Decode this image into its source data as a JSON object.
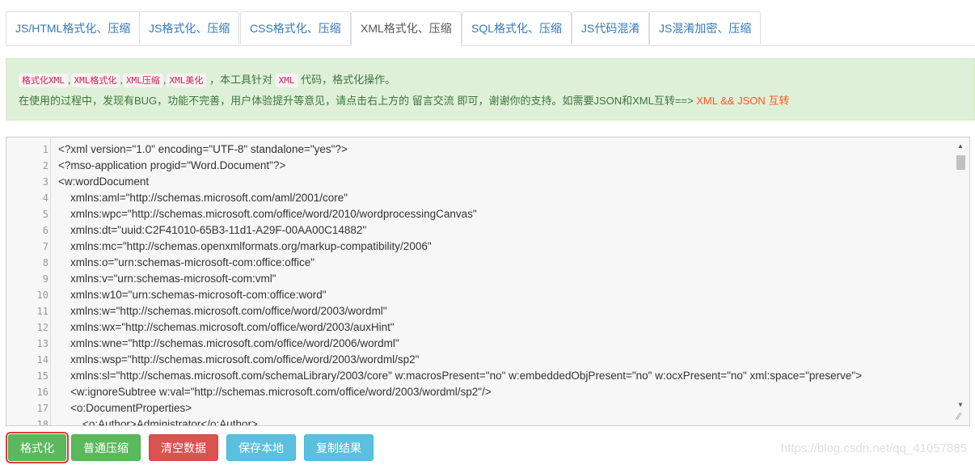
{
  "tabs": [
    {
      "label": "JS/HTML格式化、压缩",
      "active": false
    },
    {
      "label": "JS格式化、压缩",
      "active": false
    },
    {
      "label": "CSS格式化、压缩",
      "active": false
    },
    {
      "label": "XML格式化、压缩",
      "active": true
    },
    {
      "label": "SQL格式化、压缩",
      "active": false
    },
    {
      "label": "JS代码混淆",
      "active": false
    },
    {
      "label": "JS混淆加密、压缩",
      "active": false
    }
  ],
  "info": {
    "keywords": [
      "格式化XML",
      "XML格式化",
      "XML压缩",
      "XML美化"
    ],
    "sep": ",",
    "text1": "，本工具针对",
    "code_tag": "XML",
    "text2": "代码，格式化操作。",
    "line2_prefix": "在使用的过程中，发现有BUG，功能不完善，用户体验提升等意见，请点击右上方的",
    "feedback_link": "留言交流",
    "line2_middle": "即可，谢谢你的支持。如需要JSON和XML互转==>",
    "convert_link": "XML && JSON 互转"
  },
  "editor": {
    "lines": [
      {
        "n": "1",
        "text": "<?xml version=\"1.0\" encoding=\"UTF-8\" standalone=\"yes\"?>"
      },
      {
        "n": "2",
        "text": "<?mso-application progid=\"Word.Document\"?>"
      },
      {
        "n": "3",
        "text": "<w:wordDocument"
      },
      {
        "n": "4",
        "text": "    xmlns:aml=\"http://schemas.microsoft.com/aml/2001/core\""
      },
      {
        "n": "5",
        "text": "    xmlns:wpc=\"http://schemas.microsoft.com/office/word/2010/wordprocessingCanvas\""
      },
      {
        "n": "6",
        "text": "    xmlns:dt=\"uuid:C2F41010-65B3-11d1-A29F-00AA00C14882\""
      },
      {
        "n": "7",
        "text": "    xmlns:mc=\"http://schemas.openxmlformats.org/markup-compatibility/2006\""
      },
      {
        "n": "8",
        "text": "    xmlns:o=\"urn:schemas-microsoft-com:office:office\""
      },
      {
        "n": "9",
        "text": "    xmlns:v=\"urn:schemas-microsoft-com:vml\""
      },
      {
        "n": "10",
        "text": "    xmlns:w10=\"urn:schemas-microsoft-com:office:word\""
      },
      {
        "n": "11",
        "text": "    xmlns:w=\"http://schemas.microsoft.com/office/word/2003/wordml\""
      },
      {
        "n": "12",
        "text": "    xmlns:wx=\"http://schemas.microsoft.com/office/word/2003/auxHint\""
      },
      {
        "n": "13",
        "text": "    xmlns:wne=\"http://schemas.microsoft.com/office/word/2006/wordml\""
      },
      {
        "n": "14",
        "text": "    xmlns:wsp=\"http://schemas.microsoft.com/office/word/2003/wordml/sp2\""
      },
      {
        "n": "15",
        "text": "    xmlns:sl=\"http://schemas.microsoft.com/schemaLibrary/2003/core\" w:macrosPresent=\"no\" w:embeddedObjPresent=\"no\" w:ocxPresent=\"no\" xml:space=\"preserve\">"
      },
      {
        "n": "16",
        "text": "    <w:ignoreSubtree w:val=\"http://schemas.microsoft.com/office/word/2003/wordml/sp2\"/>"
      },
      {
        "n": "17",
        "text": "    <o:DocumentProperties>"
      },
      {
        "n": "18",
        "text": "        <o:Author>Administrator</o:Author>"
      }
    ]
  },
  "buttons": [
    {
      "label": "格式化",
      "style": "green",
      "highlighted": true
    },
    {
      "label": "普通压缩",
      "style": "green",
      "highlighted": false
    },
    {
      "label": "清空数据",
      "style": "red",
      "highlighted": false
    },
    {
      "label": "保存本地",
      "style": "blue",
      "highlighted": false
    },
    {
      "label": "复制结果",
      "style": "blue",
      "highlighted": false
    }
  ],
  "watermark": "https://blog.csdn.net/qq_41057885",
  "colors": {
    "accent": "#337ab7",
    "info_bg": "#dff0d8",
    "info_text": "#3c763d",
    "link_red": "#ff5722",
    "highlight": "#e53935"
  }
}
